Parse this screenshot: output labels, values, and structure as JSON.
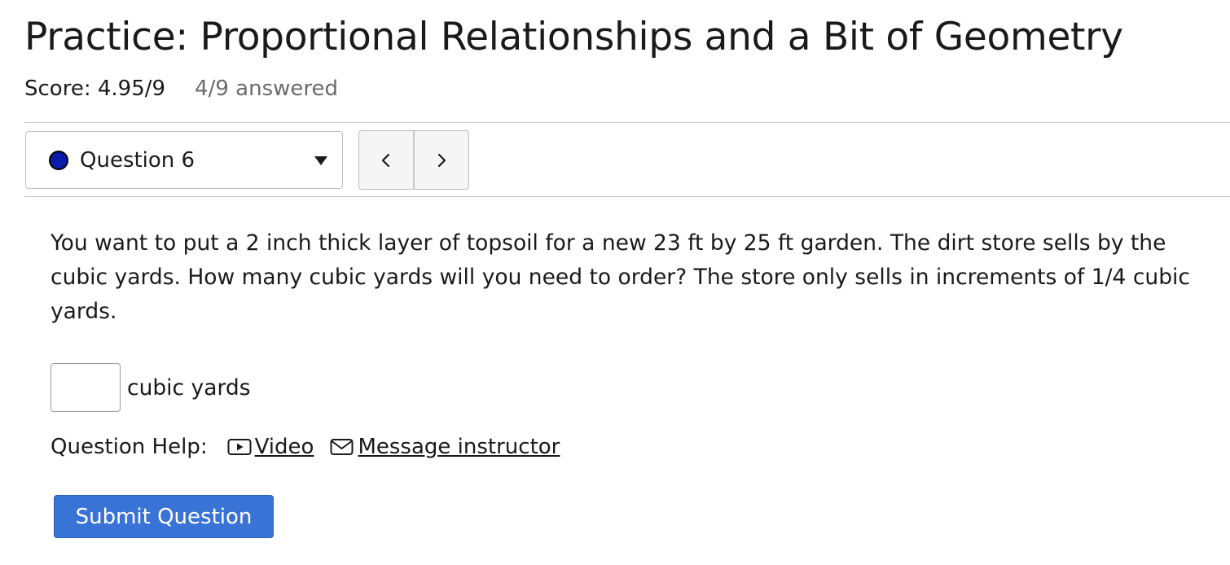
{
  "header": {
    "title": "Practice: Proportional Relationships and a Bit of Geometry",
    "score": "Score: 4.95/9",
    "answered": "4/9 answered"
  },
  "question_nav": {
    "selected": "Question 6",
    "status_color": "#0b1aa8",
    "prev_icon": "chevron-left-icon",
    "next_icon": "chevron-right-icon"
  },
  "question": {
    "text": "You want to put a 2 inch thick layer of topsoil for a new 23 ft by 25 ft garden. The dirt store sells by the cubic yards. How many cubic yards will you need to order? The store only sells in increments of 1/4 cubic yards.",
    "answer_value": "",
    "answer_unit": "cubic yards"
  },
  "help": {
    "label": "Question Help:",
    "video_label": "Video",
    "video_icon": "video-icon",
    "message_label": "Message instructor",
    "message_icon": "envelope-icon"
  },
  "actions": {
    "submit_label": "Submit Question",
    "submit_color": "#3a73d6"
  }
}
